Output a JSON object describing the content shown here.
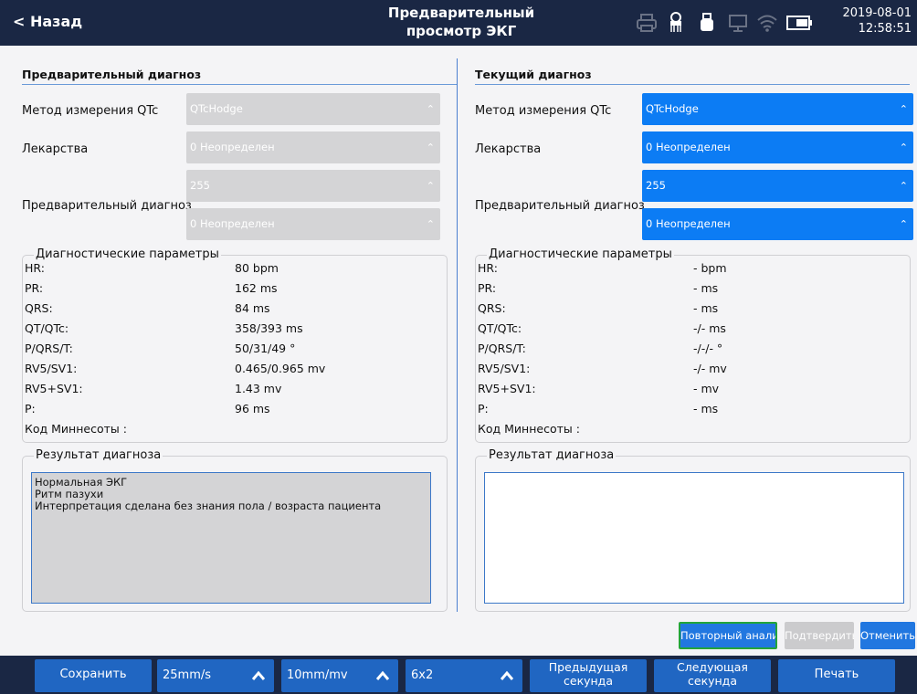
{
  "header": {
    "back_label": "< Назад",
    "title_line1": "Предварительный",
    "title_line2": "просмотр ЭКГ",
    "date": "2019-08-01",
    "time": "12:58:51"
  },
  "left": {
    "title": "Предварительный диагноз",
    "qtc_label": "Метод измерения QTc",
    "qtc_value": "QTcHodge",
    "drugs_label": "Лекарства",
    "drugs_value": "0 Неопределен",
    "prediag_label": "Предварительный диагноз",
    "prediag_value1": "255",
    "prediag_value2": "0 Неопределен",
    "params_legend": "Диагностические параметры",
    "params": [
      {
        "name": "HR:",
        "value": "80  bpm"
      },
      {
        "name": "PR:",
        "value": "162  ms"
      },
      {
        "name": "QRS:",
        "value": "84  ms"
      },
      {
        "name": "QT/QTc:",
        "value": "358/393  ms"
      },
      {
        "name": "P/QRS/T:",
        "value": "50/31/49  °"
      },
      {
        "name": "RV5/SV1:",
        "value": "0.465/0.965  mv"
      },
      {
        "name": "RV5+SV1:",
        "value": "1.43  mv"
      },
      {
        "name": "P:",
        "value": "96  ms"
      },
      {
        "name": "Код Миннесоты :",
        "value": ""
      }
    ],
    "result_legend": "Результат диагноза",
    "result_lines": [
      "Нормальная ЭКГ",
      "Ритм пазухи",
      "Интерпретация сделана без знания пола / возраста пациента"
    ]
  },
  "right": {
    "title": "Текущий диагноз",
    "qtc_label": "Метод измерения QTc",
    "qtc_value": "QTcHodge",
    "drugs_label": "Лекарства",
    "drugs_value": "0 Неопределен",
    "prediag_label": "Предварительный диагноз",
    "prediag_value1": "255",
    "prediag_value2": "0 Неопределен",
    "params_legend": "Диагностические параметры",
    "params": [
      {
        "name": "HR:",
        "value": "-  bpm"
      },
      {
        "name": "PR:",
        "value": "-  ms"
      },
      {
        "name": "QRS:",
        "value": "-  ms"
      },
      {
        "name": "QT/QTc:",
        "value": "-/-  ms"
      },
      {
        "name": "P/QRS/T:",
        "value": "-/-/-  °"
      },
      {
        "name": "RV5/SV1:",
        "value": "-/-  mv"
      },
      {
        "name": "RV5+SV1:",
        "value": "-  mv"
      },
      {
        "name": "P:",
        "value": "-  ms"
      },
      {
        "name": "Код Миннесоты :",
        "value": ""
      }
    ],
    "result_legend": "Результат диагноза"
  },
  "actions": {
    "reanalyze": "Повторный анализ",
    "confirm": "Подтвердить",
    "cancel": "Отменить"
  },
  "bottom": {
    "save": "Сохранить",
    "speed": "25mm/s",
    "gain": "10mm/mv",
    "layout": "6x2",
    "prev_line1": "Предыдущая",
    "prev_line2": "секунда",
    "next_line1": "Следующая",
    "next_line2": "секунда",
    "print": "Печать"
  },
  "colors": {
    "header_bg": "#1a2744",
    "button_blue": "#2066c2",
    "select_blue": "#0c7cf4",
    "disabled_gray": "#d4d4d6",
    "focus_green": "#23a43a"
  }
}
